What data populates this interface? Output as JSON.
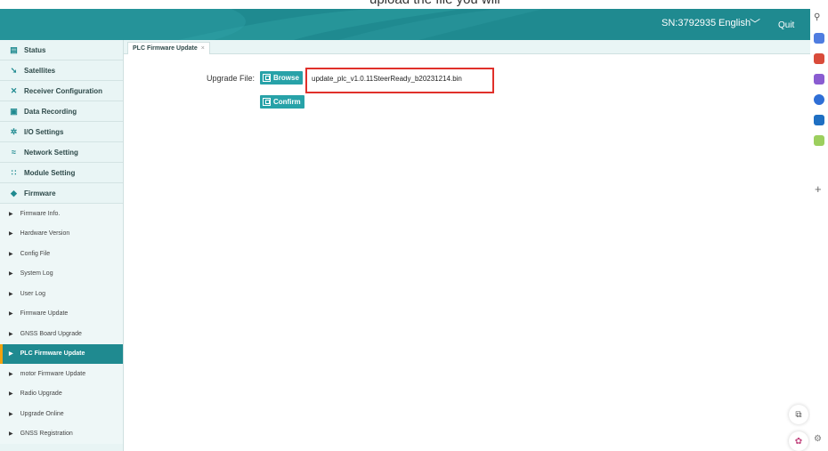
{
  "caption_fragment": "upload the file you will",
  "header": {
    "sn": "SN:3792935",
    "language": "English",
    "quit": "Quit"
  },
  "sidebar": {
    "items": [
      {
        "label": "Status",
        "icon": "status-icon"
      },
      {
        "label": "Satellites",
        "icon": "satellite-icon"
      },
      {
        "label": "Receiver Configuration",
        "icon": "tools-icon"
      },
      {
        "label": "Data Recording",
        "icon": "data-recording-icon"
      },
      {
        "label": "I/O Settings",
        "icon": "gear-icon"
      },
      {
        "label": "Network Setting",
        "icon": "wifi-icon"
      },
      {
        "label": "Module Setting",
        "icon": "module-grid-icon"
      },
      {
        "label": "Firmware",
        "icon": "firmware-icon"
      }
    ],
    "firmware_subitems": [
      "Firmware Info.",
      "Hardware Version",
      "Config File",
      "System Log",
      "User Log",
      "Firmware Update",
      "GNSS Board Upgrade",
      "PLC Firmware Update",
      "motor Firmware Update",
      "Radio Upgrade",
      "Upgrade Online",
      "GNSS Registration"
    ],
    "active_subitem": "PLC Firmware Update"
  },
  "tabs": [
    {
      "label": "PLC Firmware Update",
      "close": "×"
    }
  ],
  "form": {
    "upgrade_label": "Upgrade File:",
    "browse_label": "Browse",
    "file_name": "update_plc_v1.0.11SteerReady_b20231214.bin",
    "confirm_label": "Confirm"
  },
  "colors": {
    "header": "#1f8a90",
    "button": "#27a2a8",
    "highlight_border": "#e0302a",
    "active_marker": "#f2a20d"
  }
}
